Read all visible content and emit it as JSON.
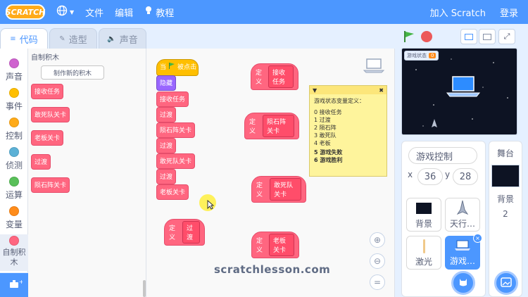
{
  "menubar": {
    "logo": "SCRATCH",
    "file": "文件",
    "edit": "编辑",
    "tutorials": "教程",
    "join": "加入 Scratch",
    "signin": "登录"
  },
  "tabs": [
    {
      "label": "代码"
    },
    {
      "label": "造型"
    },
    {
      "label": "声音"
    }
  ],
  "categories": [
    {
      "label": "声音",
      "color": "#cf63cf"
    },
    {
      "label": "事件",
      "color": "#ffbf00"
    },
    {
      "label": "控制",
      "color": "#ffab19"
    },
    {
      "label": "侦测",
      "color": "#5cb1d6"
    },
    {
      "label": "运算",
      "color": "#59c059"
    },
    {
      "label": "变量",
      "color": "#ff8c1a"
    },
    {
      "label": "自制积木",
      "color": "#ff6680"
    }
  ],
  "palette": {
    "title": "自制积木",
    "make_button": "制作新的积木",
    "blocks": [
      "接收任务",
      "敢死队关卡",
      "老板关卡",
      "过渡",
      "陨石阵关卡"
    ]
  },
  "script": {
    "hat_prefix": "当",
    "hat_suffix": "被点击",
    "stack": [
      "隐藏",
      "接收任务",
      "过渡",
      "陨石阵关卡",
      "过渡",
      "敢死队关卡",
      "过渡",
      "老板关卡"
    ],
    "define_label": "定义",
    "defines": [
      "接收任务",
      "陨石阵关卡",
      "敢死队关卡",
      "过渡",
      "老板关卡"
    ]
  },
  "note": {
    "title": "游戏状态变量定义：",
    "lines": [
      "0  接收任务",
      "1  过渡",
      "2  陨石阵",
      "3  敢死队",
      "4  老板"
    ],
    "bold_lines": [
      "5 游戏失败",
      "6 游戏胜利"
    ]
  },
  "watermark": "scratchlesson.com",
  "stage": {
    "monitor_label": "游戏状态",
    "monitor_value": "0"
  },
  "sprite_info": {
    "name": "游戏控制",
    "x_label": "x",
    "x_value": "36",
    "y_label": "y",
    "y_value": "28"
  },
  "sprites": [
    {
      "label": "背景"
    },
    {
      "label": "天行…"
    },
    {
      "label": "激光"
    },
    {
      "label": "游戏…"
    }
  ],
  "stage_pane": {
    "title": "舞台",
    "backdrops_label": "背景",
    "backdrops_count": "2"
  }
}
